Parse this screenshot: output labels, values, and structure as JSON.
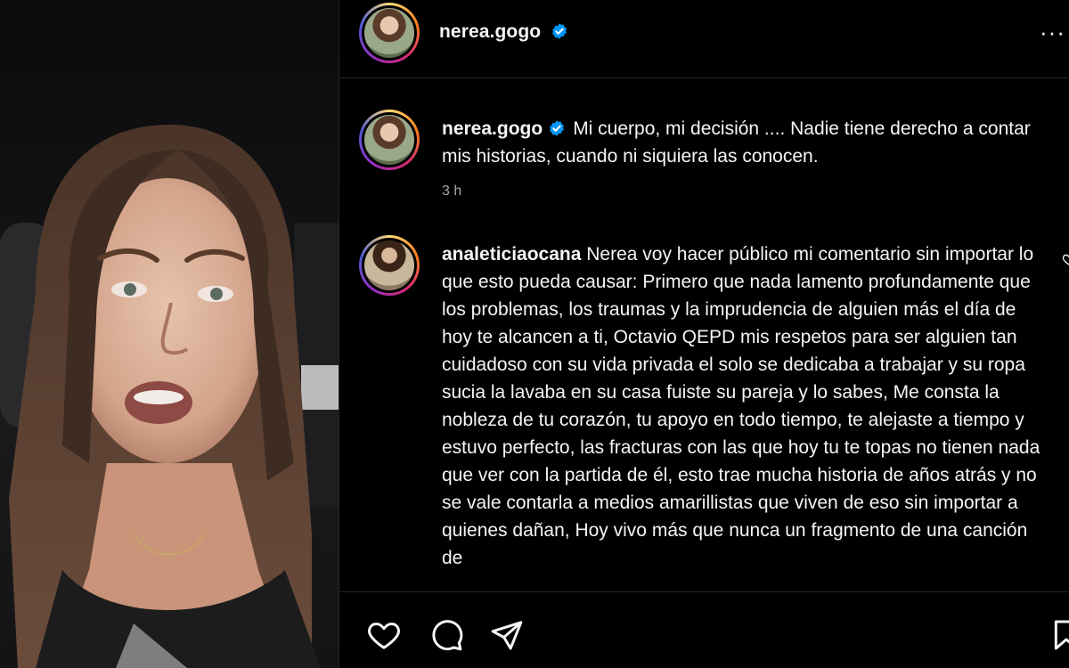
{
  "post": {
    "author": "nerea.gogo",
    "verified": true,
    "caption": "Mi cuerpo, mi decisión .... Nadie tiene derecho a contar mis historias, cuando ni siquiera las conocen.",
    "time": "3 h"
  },
  "comment": {
    "author": "analeticiaocana",
    "text": "Nerea voy hacer público mi comentario sin importar lo que esto pueda causar: Primero que nada lamento profundamente que los problemas, los traumas y la imprudencia de alguien más el día de hoy te alcancen a ti, Octavio QEPD mis respetos para ser alguien tan cuidadoso con su vida privada el solo se dedicaba a trabajar y su ropa sucia la lavaba en su casa fuiste su pareja y lo sabes, Me consta la nobleza de tu corazón, tu apoyo en todo tiempo, te alejaste a tiempo y estuvo perfecto, las fracturas con las que hoy tu te topas no tienen nada que ver con la partida de él, esto trae mucha historia de años atrás y no se vale contarla a medios amarillistas que viven de eso sin importar a quienes dañan, Hoy vivo más que nunca un fragmento de una canción de"
  },
  "header": {
    "more": "···"
  },
  "icons": {
    "like": "heart-icon",
    "comment": "comment-bubble-icon",
    "share": "paper-plane-icon",
    "save": "bookmark-icon",
    "verified": "verified-badge-icon"
  },
  "colors": {
    "verified": "#0095f6",
    "background": "#000000",
    "muted": "#a8a8a8"
  }
}
